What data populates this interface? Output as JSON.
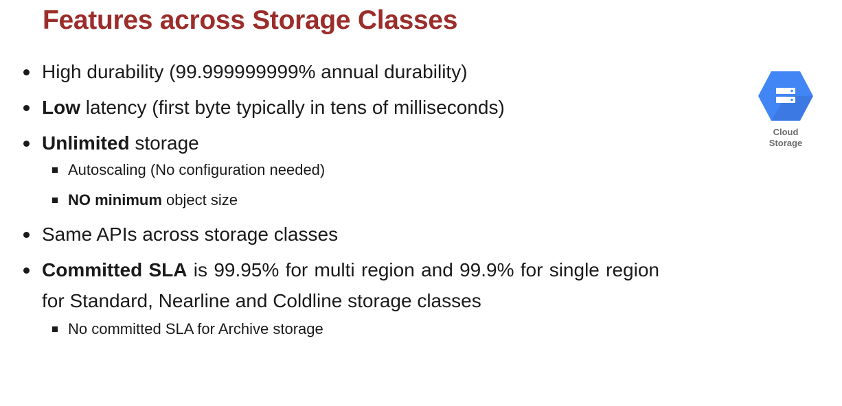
{
  "title": "Features across Storage Classes",
  "bullets": {
    "b1": "High durability (99.999999999% annual durability)",
    "b2_bold": "Low",
    "b2_rest": " latency (first byte typically in tens of milliseconds)",
    "b3_bold": "Unlimited",
    "b3_rest": " storage",
    "b3_sub1": "Autoscaling (No configuration needed)",
    "b3_sub2_bold": "NO minimum",
    "b3_sub2_rest": " object size",
    "b4": "Same APIs across storage classes",
    "b5_bold": "Committed SLA",
    "b5_rest": " is 99.95% for multi region and 99.9% for single region for Standard, Nearline and Coldline storage classes",
    "b5_sub1": "No committed SLA for Archive storage"
  },
  "logo": {
    "icon": "cloud-storage-icon",
    "label_line1": "Cloud",
    "label_line2": "Storage",
    "colors": {
      "hex_light": "#4285f4",
      "hex_dark": "#3b70d4",
      "bars": "#ffffff"
    }
  },
  "colors": {
    "title": "#9b2d2b",
    "text": "#1a1a1a"
  }
}
